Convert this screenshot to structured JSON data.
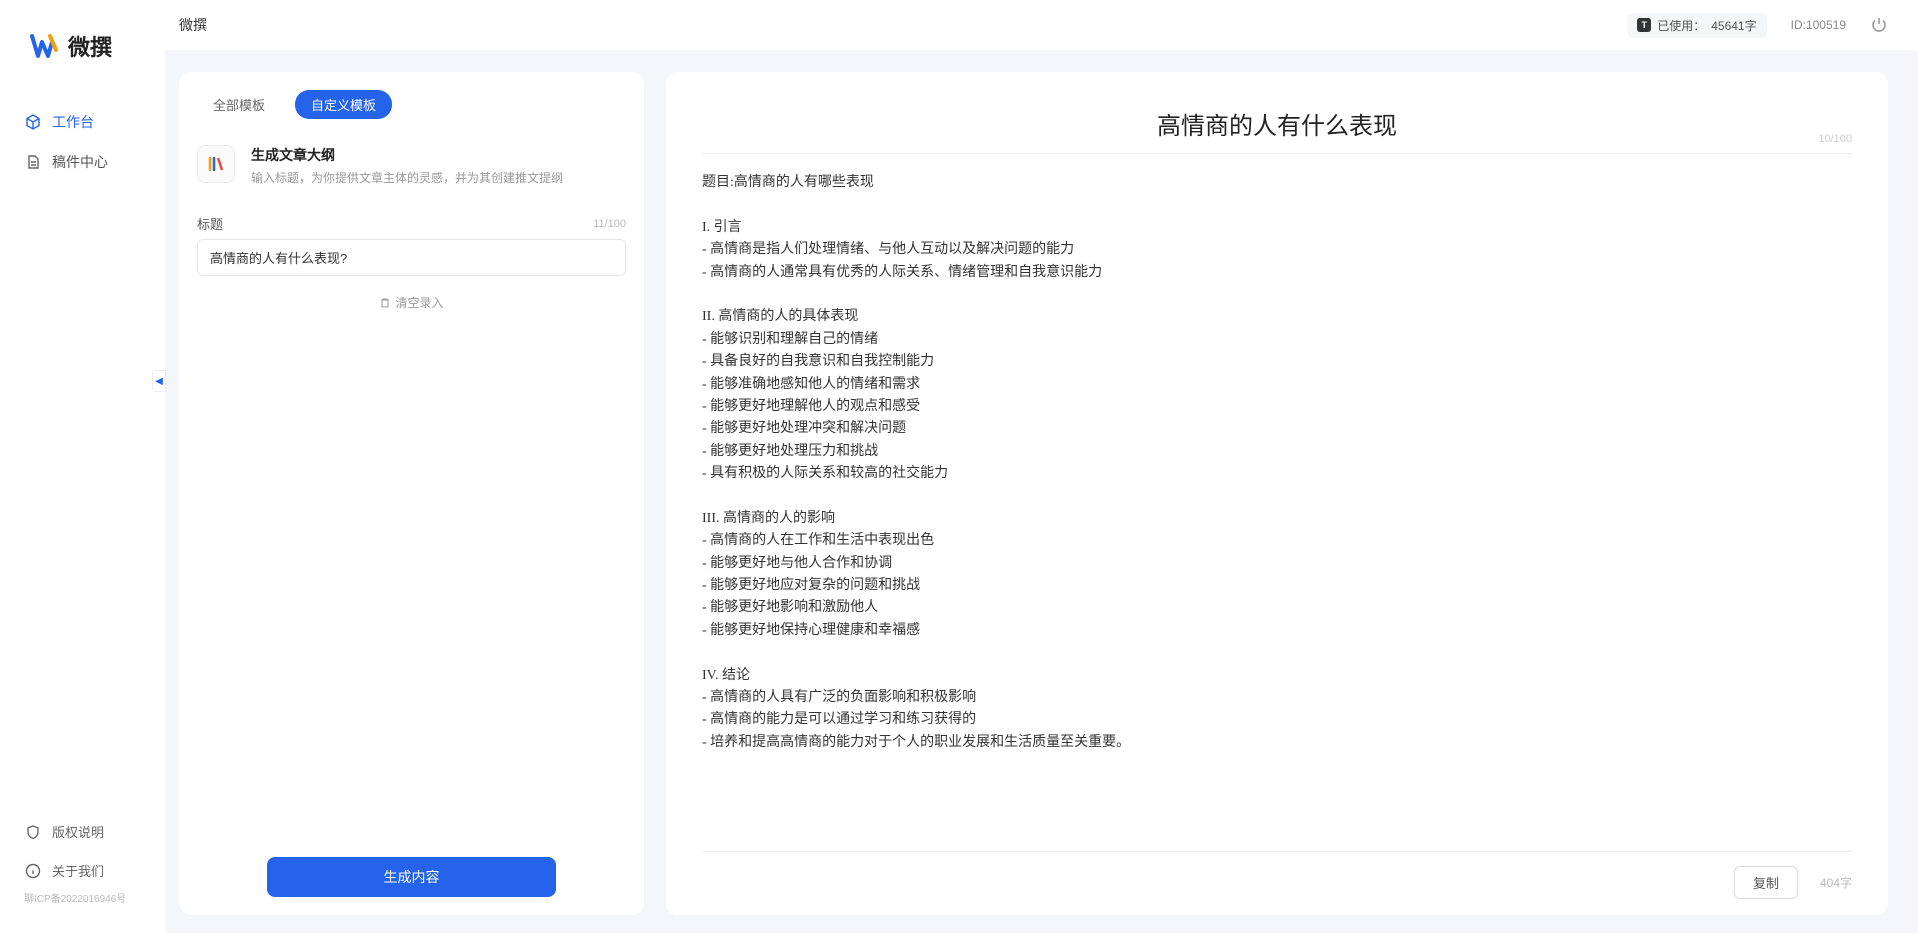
{
  "brand": {
    "name": "微撰"
  },
  "topbar": {
    "app_name": "微撰",
    "usage_label": "已使用：",
    "usage_value": "45641字",
    "id_label": "ID:100519"
  },
  "sidebar": {
    "nav": [
      {
        "label": "工作台",
        "icon": "cube"
      },
      {
        "label": "稿件中心",
        "icon": "document"
      }
    ],
    "bottom": [
      {
        "label": "版权说明",
        "icon": "shield"
      },
      {
        "label": "关于我们",
        "icon": "info"
      }
    ],
    "icp": "聊ICP备2022016946号"
  },
  "left_panel": {
    "tabs": [
      {
        "label": "全部模板",
        "active": false
      },
      {
        "label": "自定义模板",
        "active": true
      }
    ],
    "template": {
      "title": "生成文章大纲",
      "desc": "输入标题，为你提供文章主体的灵感，并为其创建推文提纲"
    },
    "form": {
      "label": "标题",
      "counter": "11/100",
      "value": "高情商的人有什么表现?",
      "clear": "清空录入",
      "generate": "生成内容"
    }
  },
  "result": {
    "title": "高情商的人有什么表现",
    "title_counter": "10/100",
    "body": "题目:高情商的人有哪些表现\n\nI. 引言\n- 高情商是指人们处理情绪、与他人互动以及解决问题的能力\n- 高情商的人通常具有优秀的人际关系、情绪管理和自我意识能力\n\nII. 高情商的人的具体表现\n- 能够识别和理解自己的情绪\n- 具备良好的自我意识和自我控制能力\n- 能够准确地感知他人的情绪和需求\n- 能够更好地理解他人的观点和感受\n- 能够更好地处理冲突和解决问题\n- 能够更好地处理压力和挑战\n- 具有积极的人际关系和较高的社交能力\n\nIII. 高情商的人的影响\n- 高情商的人在工作和生活中表现出色\n- 能够更好地与他人合作和协调\n- 能够更好地应对复杂的问题和挑战\n- 能够更好地影响和激励他人\n- 能够更好地保持心理健康和幸福感\n\nIV. 结论\n- 高情商的人具有广泛的负面影响和积极影响\n- 高情商的能力是可以通过学习和练习获得的\n- 培养和提高高情商的能力对于个人的职业发展和生活质量至关重要。",
    "copy": "复制",
    "word_count": "404字"
  }
}
